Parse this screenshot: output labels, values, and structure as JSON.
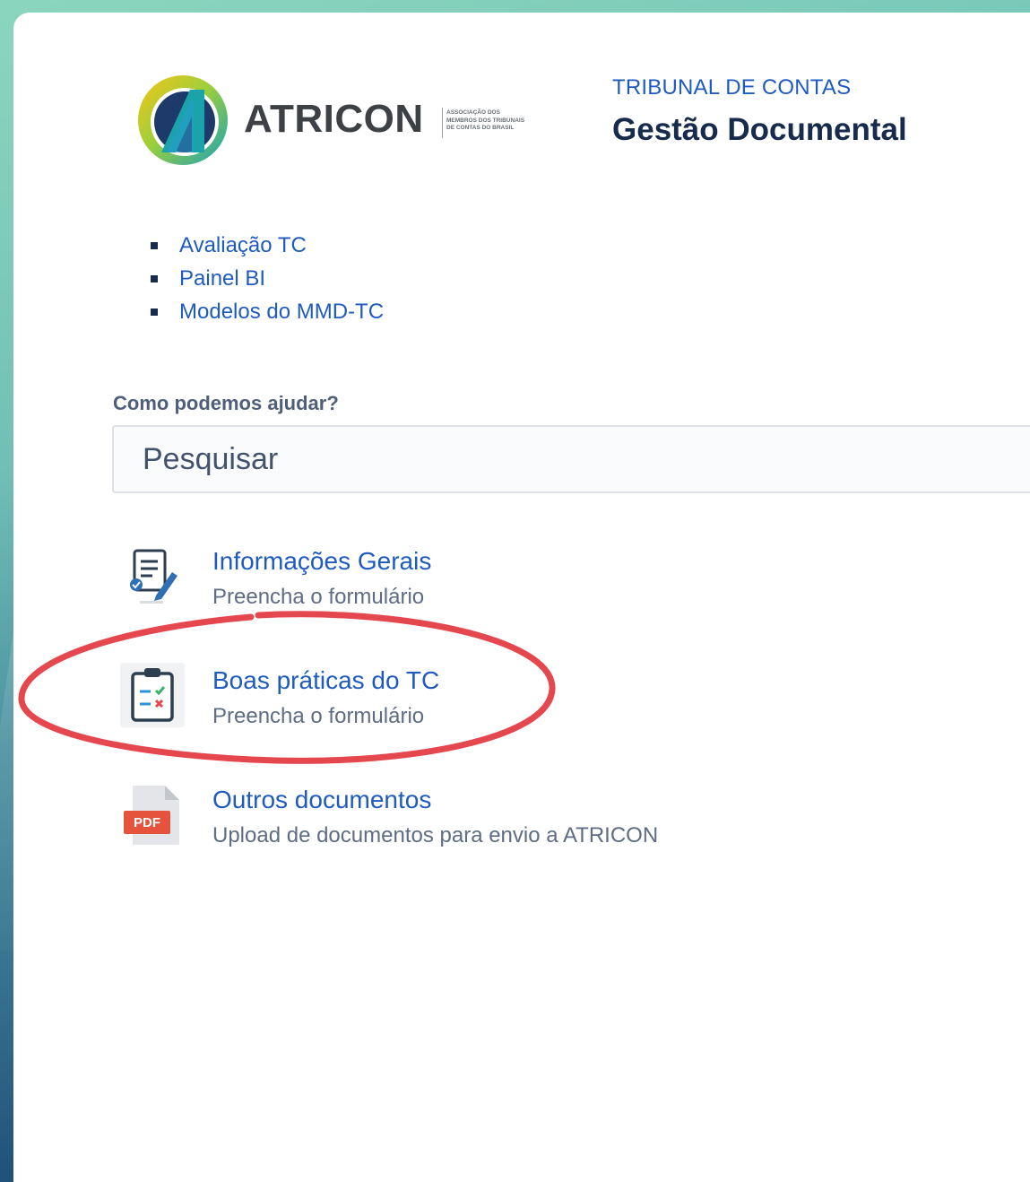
{
  "brand": {
    "logo_text": "ATRICON",
    "logo_subtitle_lines": [
      "ASSOCIAÇÃO DOS",
      "MEMBROS DOS TRIBUNAIS",
      "DE CONTAS DO BRASIL"
    ],
    "colors": {
      "teal": "#1aa3a8",
      "yellow": "#f2c21b",
      "navy": "#1e3a6b",
      "dark": "#3d4146"
    }
  },
  "header": {
    "org": "TRIBUNAL DE CONTAS",
    "title": "Gestão Documental"
  },
  "nav": {
    "items": [
      {
        "label": "Avaliação TC"
      },
      {
        "label": "Painel BI"
      },
      {
        "label": "Modelos do MMD-TC"
      }
    ]
  },
  "search": {
    "label": "Como podemos ajudar?",
    "placeholder": "Pesquisar"
  },
  "request_types": [
    {
      "title": "Informações Gerais",
      "description": "Preencha o formulário",
      "icon": "form-edit-icon"
    },
    {
      "title": "Boas práticas do TC",
      "description": "Preencha o formulário",
      "icon": "clipboard-checklist-icon"
    },
    {
      "title": "Outros documentos",
      "description": "Upload de documentos para envio a ATRICON",
      "icon": "pdf-file-icon"
    }
  ],
  "annotation": {
    "shape": "ellipse",
    "color": "#e5474f",
    "highlights": "Boas práticas do TC"
  }
}
